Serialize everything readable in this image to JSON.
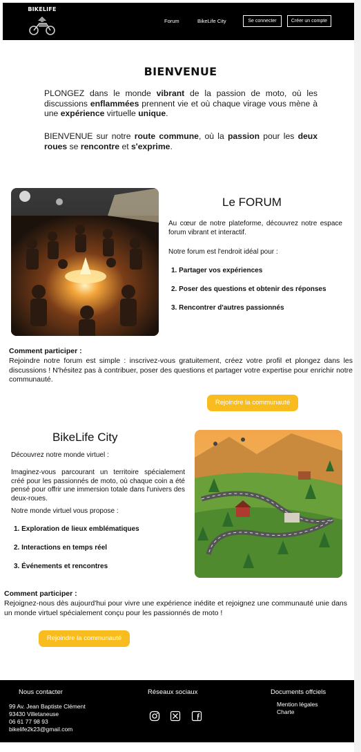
{
  "header": {
    "logo_text": "BIKELIFE",
    "nav": {
      "forum": "Forum",
      "city": "BikeLife City",
      "login": "Se connecter",
      "signup": "Créer un compte"
    }
  },
  "welcome": {
    "title": "BIENVENUE",
    "p1": [
      {
        "t": "PLONGEZ dans le monde ",
        "b": false
      },
      {
        "t": "vibrant",
        "b": true
      },
      {
        "t": " de la passion de moto, où les discussions ",
        "b": false
      },
      {
        "t": "enflammées",
        "b": true
      },
      {
        "t": " prennent vie et où chaque virage vous mène à une ",
        "b": false
      },
      {
        "t": "expérience",
        "b": true
      },
      {
        "t": " virtuelle ",
        "b": false
      },
      {
        "t": "unique",
        "b": true
      },
      {
        "t": ".",
        "b": false
      }
    ],
    "p2": [
      {
        "t": "BIENVENUE sur notre ",
        "b": false
      },
      {
        "t": "route commune",
        "b": true
      },
      {
        "t": ", où la ",
        "b": false
      },
      {
        "t": "passion",
        "b": true
      },
      {
        "t": " pour les ",
        "b": false
      },
      {
        "t": "deux roues",
        "b": true
      },
      {
        "t": " se ",
        "b": false
      },
      {
        "t": "rencontre",
        "b": true
      },
      {
        "t": " et ",
        "b": false
      },
      {
        "t": "s'exprime",
        "b": true
      },
      {
        "t": ".",
        "b": false
      }
    ]
  },
  "forum": {
    "title": "Le FORUM",
    "intro": "Au cœur de notre plateforme, découvrez notre espace forum vibrant et interactif.",
    "lead": "Notre forum est l'endroit idéal pour :",
    "items": [
      "1.  Partager vos expériences",
      "2.  Poser des questions et obtenir des réponses",
      "3.  Rencontrer d'autres passionnés"
    ],
    "cp_title": "Comment participer :",
    "cp_text": "Rejoindre notre forum est simple : inscrivez-vous gratuitement, créez votre profil et plongez dans les discussions ! N'hésitez pas à contribuer, poser des questions et partager votre expertise pour enrichir notre communauté.",
    "button": "Rejoindre la communauté"
  },
  "city": {
    "title": "BikeLife City",
    "lead": "Découvrez notre monde virtuel :",
    "intro": "Imaginez-vous parcourant un territoire spécialement créé pour les passionnés de moto, où chaque coin a été pensé pour offrir une immersion totale dans l'univers des deux-roues.",
    "lead2": "Notre monde virtuel vous propose :",
    "items": [
      "1.  Exploration de lieux emblématiques",
      "2.  Interactions en temps réel",
      "3.  Événements et rencontres"
    ],
    "cp_title": "Comment participer :",
    "cp_text": "Rejoignez-nous dès aujourd'hui pour vivre une expérience inédite et rejoignez une communauté unie dans un monde virtuel spécialement conçu pour les passionnés de moto !",
    "button": "Rejoindre la communauté"
  },
  "footer": {
    "contact_title": "Nous contacter",
    "contact_lines": [
      "99 Av. Jean Baptiste Clément",
      "93430 Villetaneuse",
      "06 61 77 98 93",
      "bikelife2k23@gmail.com"
    ],
    "social_title": "Réseaux sociaux",
    "social_icons": [
      "instagram-icon",
      "x-icon",
      "facebook-icon"
    ],
    "docs_title": "Documents offciels",
    "docs": [
      "Mention légales",
      "Charte"
    ]
  },
  "colors": {
    "header_bg": "#000000",
    "button": "#f8bc1e",
    "footer_bg": "#000000"
  }
}
